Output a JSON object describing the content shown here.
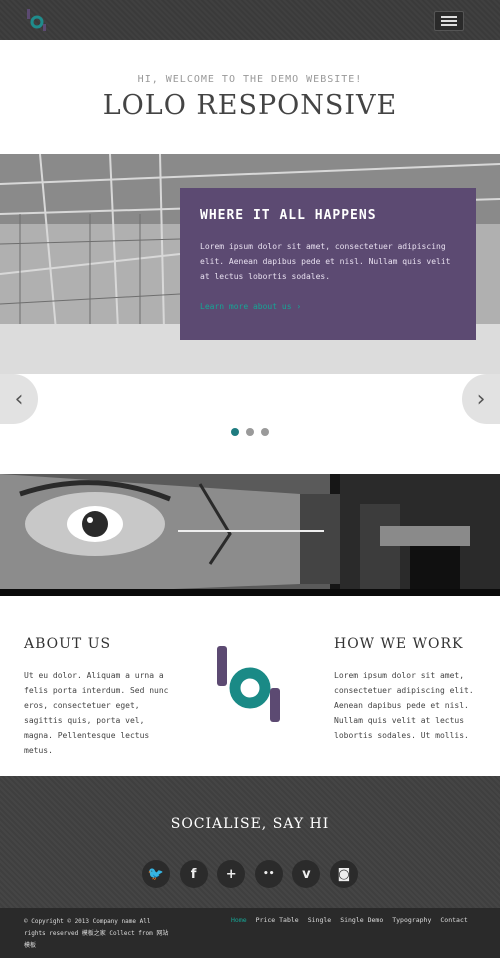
{
  "header": {
    "logo_icon": "lo-logo-icon",
    "menu_icon": "hamburger-menu-icon"
  },
  "hero": {
    "subtitle": "HI, WELCOME TO THE DEMO WEBSITE!",
    "title": "LOLO RESPONSIVE"
  },
  "slider": {
    "card_title": "WHERE IT ALL HAPPENS",
    "card_text": "Lorem ipsum dolor sit amet, consectetuer adipiscing elit. Aenean dapibus pede et nisl. Nullam quis velit at lectus lobortis sodales.",
    "card_link": "Learn more about us  ›",
    "prev_glyph": "‹",
    "next_glyph": "›",
    "slide_count": 3,
    "active_slide": 1
  },
  "about": {
    "title": "ABOUT US",
    "text": "Ut eu dolor. Aliquam a urna a felis porta interdum. Sed nunc eros, consectetuer eget, sagittis quis, porta vel, magna. Pellentesque lectus metus."
  },
  "how": {
    "title": "HOW WE WORK",
    "text": "Lorem ipsum dolor sit amet, consectetuer adipiscing elit. Aenean dapibus pede et nisl. Nullam quis velit at lectus lobortis sodales. Ut mollis."
  },
  "social": {
    "title": "SOCIALISE, SAY HI",
    "icons": [
      {
        "name": "twitter-icon",
        "glyph": "🐦"
      },
      {
        "name": "facebook-icon",
        "glyph": "f"
      },
      {
        "name": "google-plus-icon",
        "glyph": "+"
      },
      {
        "name": "flickr-icon",
        "glyph": "••"
      },
      {
        "name": "vimeo-icon",
        "glyph": "v"
      },
      {
        "name": "instagram-icon",
        "glyph": "◙"
      }
    ]
  },
  "footer": {
    "copyright": "© Copyright © 2013 Company name All rights reserved 模板之家 Collect from 网站模板",
    "nav": [
      "Home",
      "Price Table",
      "Single",
      "Single Demo",
      "Typography",
      "Contact"
    ],
    "active_nav": "Home"
  },
  "colors": {
    "accent": "#16a595",
    "card": "#5c4a72",
    "dark": "#3f3f3f"
  }
}
